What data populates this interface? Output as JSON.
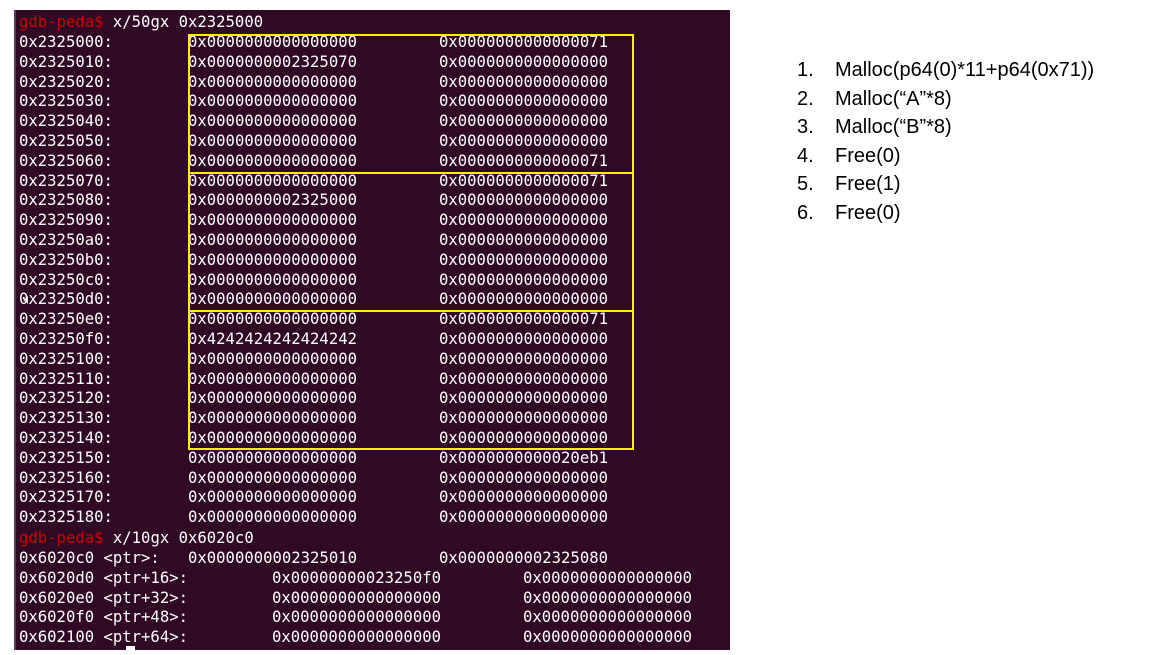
{
  "terminal": {
    "prompt": "gdb-peda$",
    "command1": " x/50gx 0x2325000",
    "command2": " x/10gx 0x6020c0",
    "memory_rows": [
      {
        "addr": "0x2325000:",
        "v1": "0x0000000000000000",
        "v2": "0x0000000000000071"
      },
      {
        "addr": "0x2325010:",
        "v1": "0x0000000002325070",
        "v2": "0x0000000000000000"
      },
      {
        "addr": "0x2325020:",
        "v1": "0x0000000000000000",
        "v2": "0x0000000000000000"
      },
      {
        "addr": "0x2325030:",
        "v1": "0x0000000000000000",
        "v2": "0x0000000000000000"
      },
      {
        "addr": "0x2325040:",
        "v1": "0x0000000000000000",
        "v2": "0x0000000000000000"
      },
      {
        "addr": "0x2325050:",
        "v1": "0x0000000000000000",
        "v2": "0x0000000000000000"
      },
      {
        "addr": "0x2325060:",
        "v1": "0x0000000000000000",
        "v2": "0x0000000000000071"
      },
      {
        "addr": "0x2325070:",
        "v1": "0x0000000000000000",
        "v2": "0x0000000000000071"
      },
      {
        "addr": "0x2325080:",
        "v1": "0x0000000002325000",
        "v2": "0x0000000000000000"
      },
      {
        "addr": "0x2325090:",
        "v1": "0x0000000000000000",
        "v2": "0x0000000000000000"
      },
      {
        "addr": "0x23250a0:",
        "v1": "0x0000000000000000",
        "v2": "0x0000000000000000"
      },
      {
        "addr": "0x23250b0:",
        "v1": "0x0000000000000000",
        "v2": "0x0000000000000000"
      },
      {
        "addr": "0x23250c0:",
        "v1": "0x0000000000000000",
        "v2": "0x0000000000000000"
      },
      {
        "addr": "0x23250d0:",
        "v1": "0x0000000000000000",
        "v2": "0x0000000000000000"
      },
      {
        "addr": "0x23250e0:",
        "v1": "0x0000000000000000",
        "v2": "0x0000000000000071"
      },
      {
        "addr": "0x23250f0:",
        "v1": "0x4242424242424242",
        "v2": "0x0000000000000000"
      },
      {
        "addr": "0x2325100:",
        "v1": "0x0000000000000000",
        "v2": "0x0000000000000000"
      },
      {
        "addr": "0x2325110:",
        "v1": "0x0000000000000000",
        "v2": "0x0000000000000000"
      },
      {
        "addr": "0x2325120:",
        "v1": "0x0000000000000000",
        "v2": "0x0000000000000000"
      },
      {
        "addr": "0x2325130:",
        "v1": "0x0000000000000000",
        "v2": "0x0000000000000000"
      },
      {
        "addr": "0x2325140:",
        "v1": "0x0000000000000000",
        "v2": "0x0000000000000000"
      },
      {
        "addr": "0x2325150:",
        "v1": "0x0000000000000000",
        "v2": "0x0000000000020eb1"
      },
      {
        "addr": "0x2325160:",
        "v1": "0x0000000000000000",
        "v2": "0x0000000000000000"
      },
      {
        "addr": "0x2325170:",
        "v1": "0x0000000000000000",
        "v2": "0x0000000000000000"
      },
      {
        "addr": "0x2325180:",
        "v1": "0x0000000000000000",
        "v2": "0x0000000000000000"
      }
    ],
    "ptr_rows": [
      {
        "addr": "0x6020c0 <ptr>:",
        "v1": "0x0000000002325010",
        "v2": "0x0000000002325080"
      },
      {
        "addr": "0x6020d0 <ptr+16>:",
        "v1": "0x00000000023250f0",
        "v2": "0x0000000000000000"
      },
      {
        "addr": "0x6020e0 <ptr+32>:",
        "v1": "0x0000000000000000",
        "v2": "0x0000000000000000"
      },
      {
        "addr": "0x6020f0 <ptr+48>:",
        "v1": "0x0000000000000000",
        "v2": "0x0000000000000000"
      },
      {
        "addr": "0x602100 <ptr+64>:",
        "v1": "0x0000000000000000",
        "v2": "0x0000000000000000"
      }
    ],
    "highlight_color": "#ffee00",
    "background_color": "#300a24",
    "prompt_color": "#cc0000"
  },
  "steps": [
    {
      "num": "1.",
      "text": "Malloc(p64(0)*11+p64(0x71))"
    },
    {
      "num": "2.",
      "text": "Malloc(“A”*8)"
    },
    {
      "num": "3.",
      "text": "Malloc(“B”*8)"
    },
    {
      "num": "4.",
      "text": "Free(0)"
    },
    {
      "num": "5.",
      "text": "Free(1)"
    },
    {
      "num": "6.",
      "text": "Free(0)"
    }
  ]
}
